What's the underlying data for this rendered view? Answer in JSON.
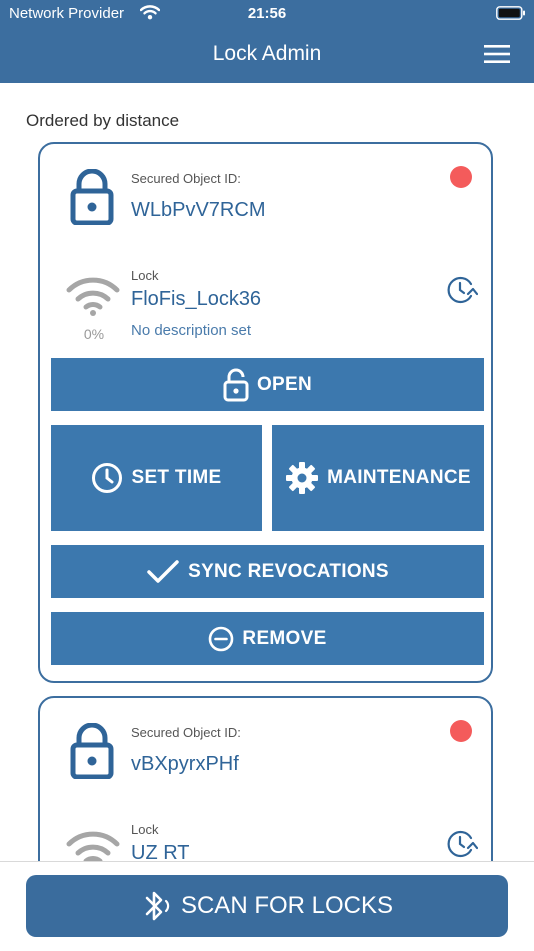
{
  "status_bar": {
    "carrier": "Network Provider",
    "time": "21:56"
  },
  "nav": {
    "title": "Lock Admin"
  },
  "list": {
    "section_label": "Ordered by distance"
  },
  "cards": [
    {
      "object_id_label": "Secured Object ID:",
      "object_id": "WLbPvV7RCM",
      "lock_label": "Lock",
      "lock_name": "FloFis_Lock36",
      "signal_percent": "0%",
      "description": "No description set",
      "buttons": {
        "open": "OPEN",
        "set_time": "SET TIME",
        "maintenance": "MAINTENANCE",
        "sync_revocations": "SYNC REVOCATIONS",
        "remove": "REMOVE"
      }
    },
    {
      "object_id_label": "Secured Object ID:",
      "object_id": "vBXpyrxPHf",
      "lock_label": "Lock",
      "lock_name": "UZ RT"
    }
  ],
  "bottom": {
    "scan_label": "SCAN FOR LOCKS"
  },
  "colors": {
    "header": "#3c6e9f",
    "button": "#3c78ae",
    "status_dot": "#f45b5b",
    "text_blue": "#2f6498"
  },
  "icons": [
    "wifi-status-icon",
    "battery-icon",
    "hamburger-menu-icon",
    "padlock-icon",
    "wifi-signal-icon",
    "history-clock-icon",
    "clock-icon",
    "gear-icon",
    "checkmark-icon",
    "minus-circle-icon",
    "bluetooth-icon"
  ]
}
